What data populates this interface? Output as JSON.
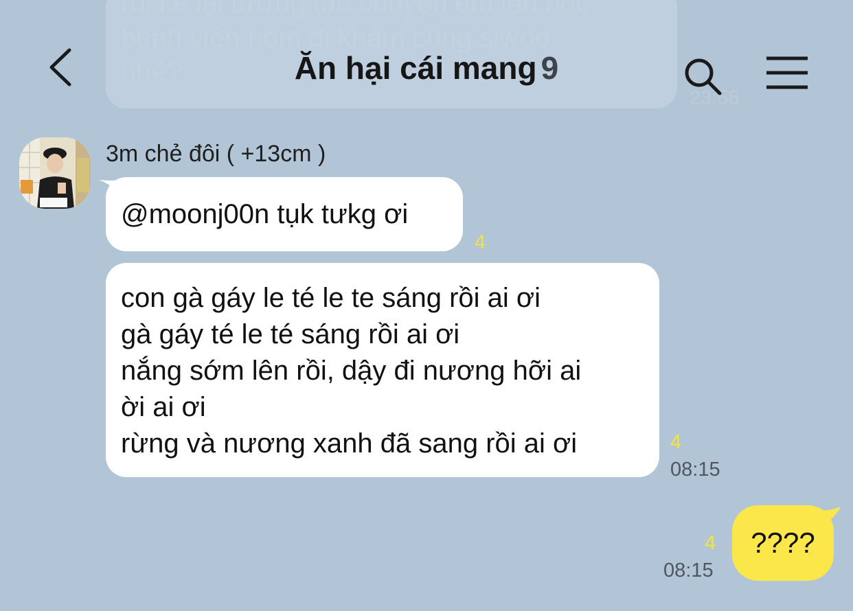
{
  "header": {
    "title": "Ăn hại cái mang",
    "member_count": "9"
  },
  "previous_message": {
    "lines": [
      "rồi kể lại tương tận chuyện em lên nóc",
      "bệnh viện hôm đi khám cùng siwoo",
      "nhé?"
    ],
    "time": "23:56"
  },
  "sender": {
    "name": "3m chẻ đôi ( +13cm )"
  },
  "messages": [
    {
      "text": "@moonj00n tụk tưkg ơi",
      "unread": "4"
    },
    {
      "lines": [
        "con gà gáy le té le te sáng rồi ai ơi",
        "gà gáy té le té sáng rồi ai ơi",
        "nắng sớm lên rồi, dậy đi nương hỡi ai",
        "ời ai ơi",
        "rừng và nương xanh đã sang rồi ai ơi"
      ],
      "unread": "4",
      "time": "08:15"
    }
  ],
  "my_message": {
    "text": "????",
    "unread": "4",
    "time": "08:15"
  },
  "colors": {
    "background": "#b2c5d7",
    "bubble_other": "#ffffff",
    "bubble_mine": "#fce74b",
    "unread": "#f3e33f",
    "time": "#50565e"
  },
  "icons": {
    "back": "back-chevron-icon",
    "search": "search-icon",
    "menu": "menu-icon"
  }
}
